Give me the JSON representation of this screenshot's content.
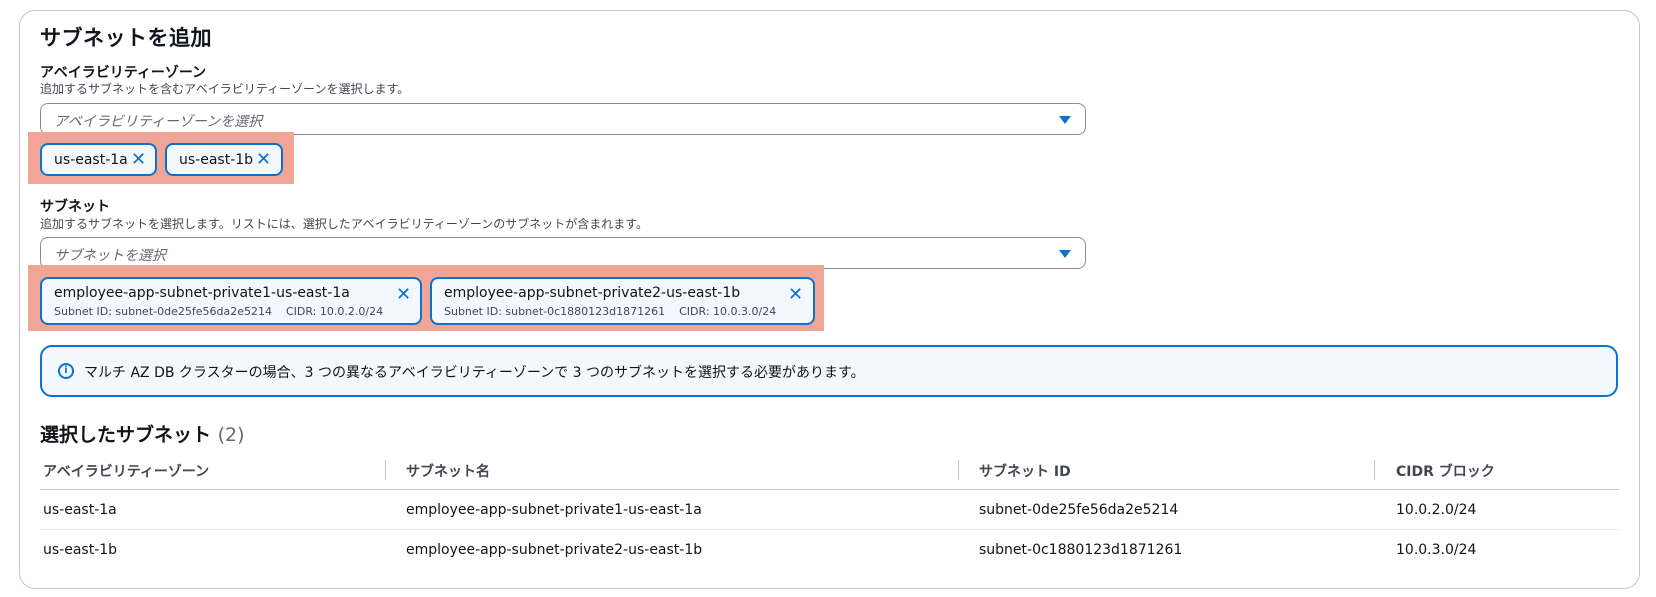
{
  "section": {
    "title": "サブネットを追加"
  },
  "az_field": {
    "label": "アベイラビリティーゾーン",
    "description": "追加するサブネットを含むアベイラビリティーゾーンを選択します。",
    "placeholder": "アベイラビリティーゾーンを選択",
    "tokens": [
      {
        "label": "us-east-1a"
      },
      {
        "label": "us-east-1b"
      }
    ]
  },
  "subnet_field": {
    "label": "サブネット",
    "description": "追加するサブネットを選択します。リストには、選択したアベイラビリティーゾーンのサブネットが含まれます。",
    "placeholder": "サブネットを選択",
    "tokens": [
      {
        "name": "employee-app-subnet-private1-us-east-1a",
        "subnet_id": "Subnet ID: subnet-0de25fe56da2e5214",
        "cidr": "CIDR: 10.0.2.0/24"
      },
      {
        "name": "employee-app-subnet-private2-us-east-1b",
        "subnet_id": "Subnet ID: subnet-0c1880123d1871261",
        "cidr": "CIDR: 10.0.3.0/24"
      }
    ]
  },
  "alert": {
    "icon": "info-icon",
    "message": "マルチ AZ DB クラスターの場合、3 つの異なるアベイラビリティーゾーンで 3 つのサブネットを選択する必要があります。"
  },
  "selected_table": {
    "title": "選択したサブネット",
    "count": "(2)",
    "columns": [
      "アベイラビリティーゾーン",
      "サブネット名",
      "サブネット ID",
      "CIDR ブロック"
    ],
    "rows": [
      [
        "us-east-1a",
        "employee-app-subnet-private1-us-east-1a",
        "subnet-0de25fe56da2e5214",
        "10.0.2.0/24"
      ],
      [
        "us-east-1b",
        "employee-app-subnet-private2-us-east-1b",
        "subnet-0c1880123d1871261",
        "10.0.3.0/24"
      ]
    ]
  },
  "colors": {
    "accent": "#0972d3",
    "highlight": "#f0a597",
    "token_bg": "#f2f8fd"
  }
}
